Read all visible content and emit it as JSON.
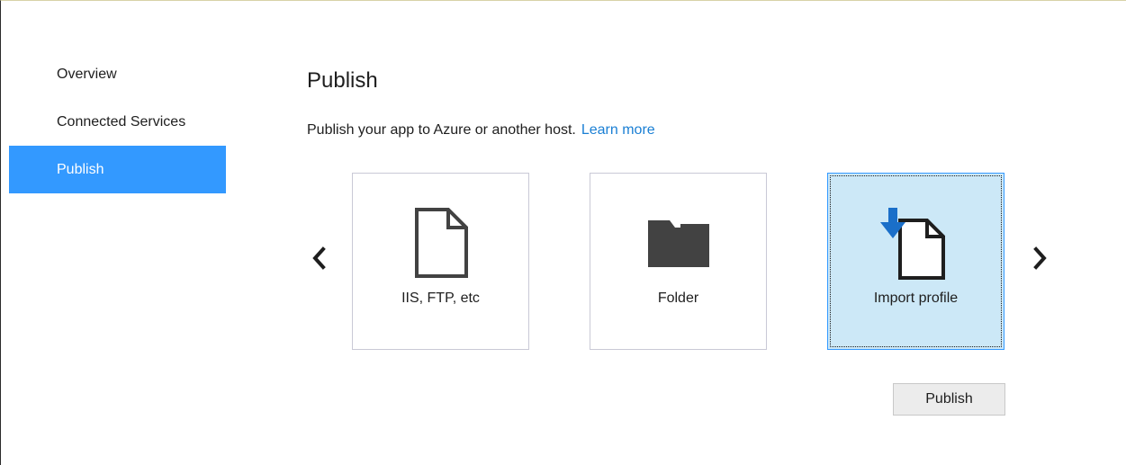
{
  "sidebar": {
    "items": [
      {
        "label": "Overview"
      },
      {
        "label": "Connected Services"
      },
      {
        "label": "Publish"
      }
    ]
  },
  "main": {
    "title": "Publish",
    "description": "Publish your app to Azure or another host.",
    "learn_more": "Learn more",
    "targets": [
      {
        "label": "IIS, FTP, etc",
        "icon": "document-icon"
      },
      {
        "label": "Folder",
        "icon": "folder-icon"
      },
      {
        "label": "Import profile",
        "icon": "import-document-icon",
        "selected": true
      }
    ],
    "publish_button": "Publish"
  },
  "colors": {
    "accent": "#3399ff",
    "link": "#1a7fd4",
    "selected_card_bg": "#cce8f7"
  }
}
